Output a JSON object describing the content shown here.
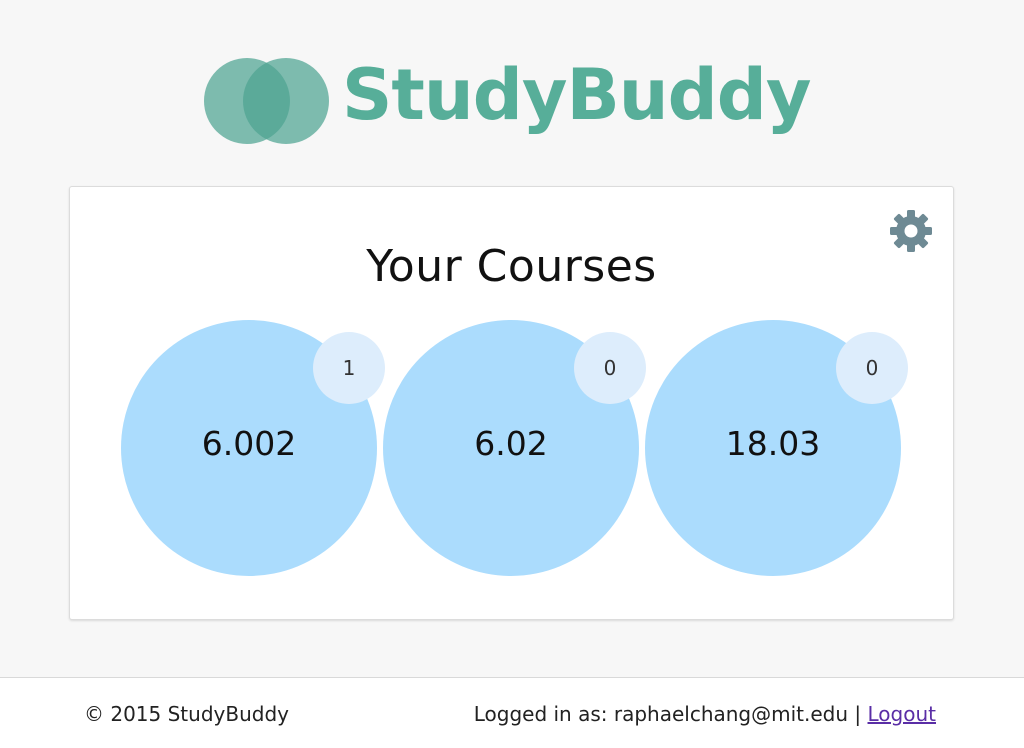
{
  "brand": {
    "name": "StudyBuddy",
    "accent_color": "#57ae99",
    "logo_icon": "overlapping-circles-logo"
  },
  "card": {
    "title": "Your Courses",
    "settings_icon": "gear-icon"
  },
  "courses": [
    {
      "label": "6.002",
      "count": "1"
    },
    {
      "label": "6.02",
      "count": "0"
    },
    {
      "label": "18.03",
      "count": "0"
    }
  ],
  "footer": {
    "copyright": "© 2015 StudyBuddy",
    "logged_in_text": "Logged in as: raphaelchang@mit.edu",
    "separator": "|",
    "logout_label": "Logout"
  }
}
